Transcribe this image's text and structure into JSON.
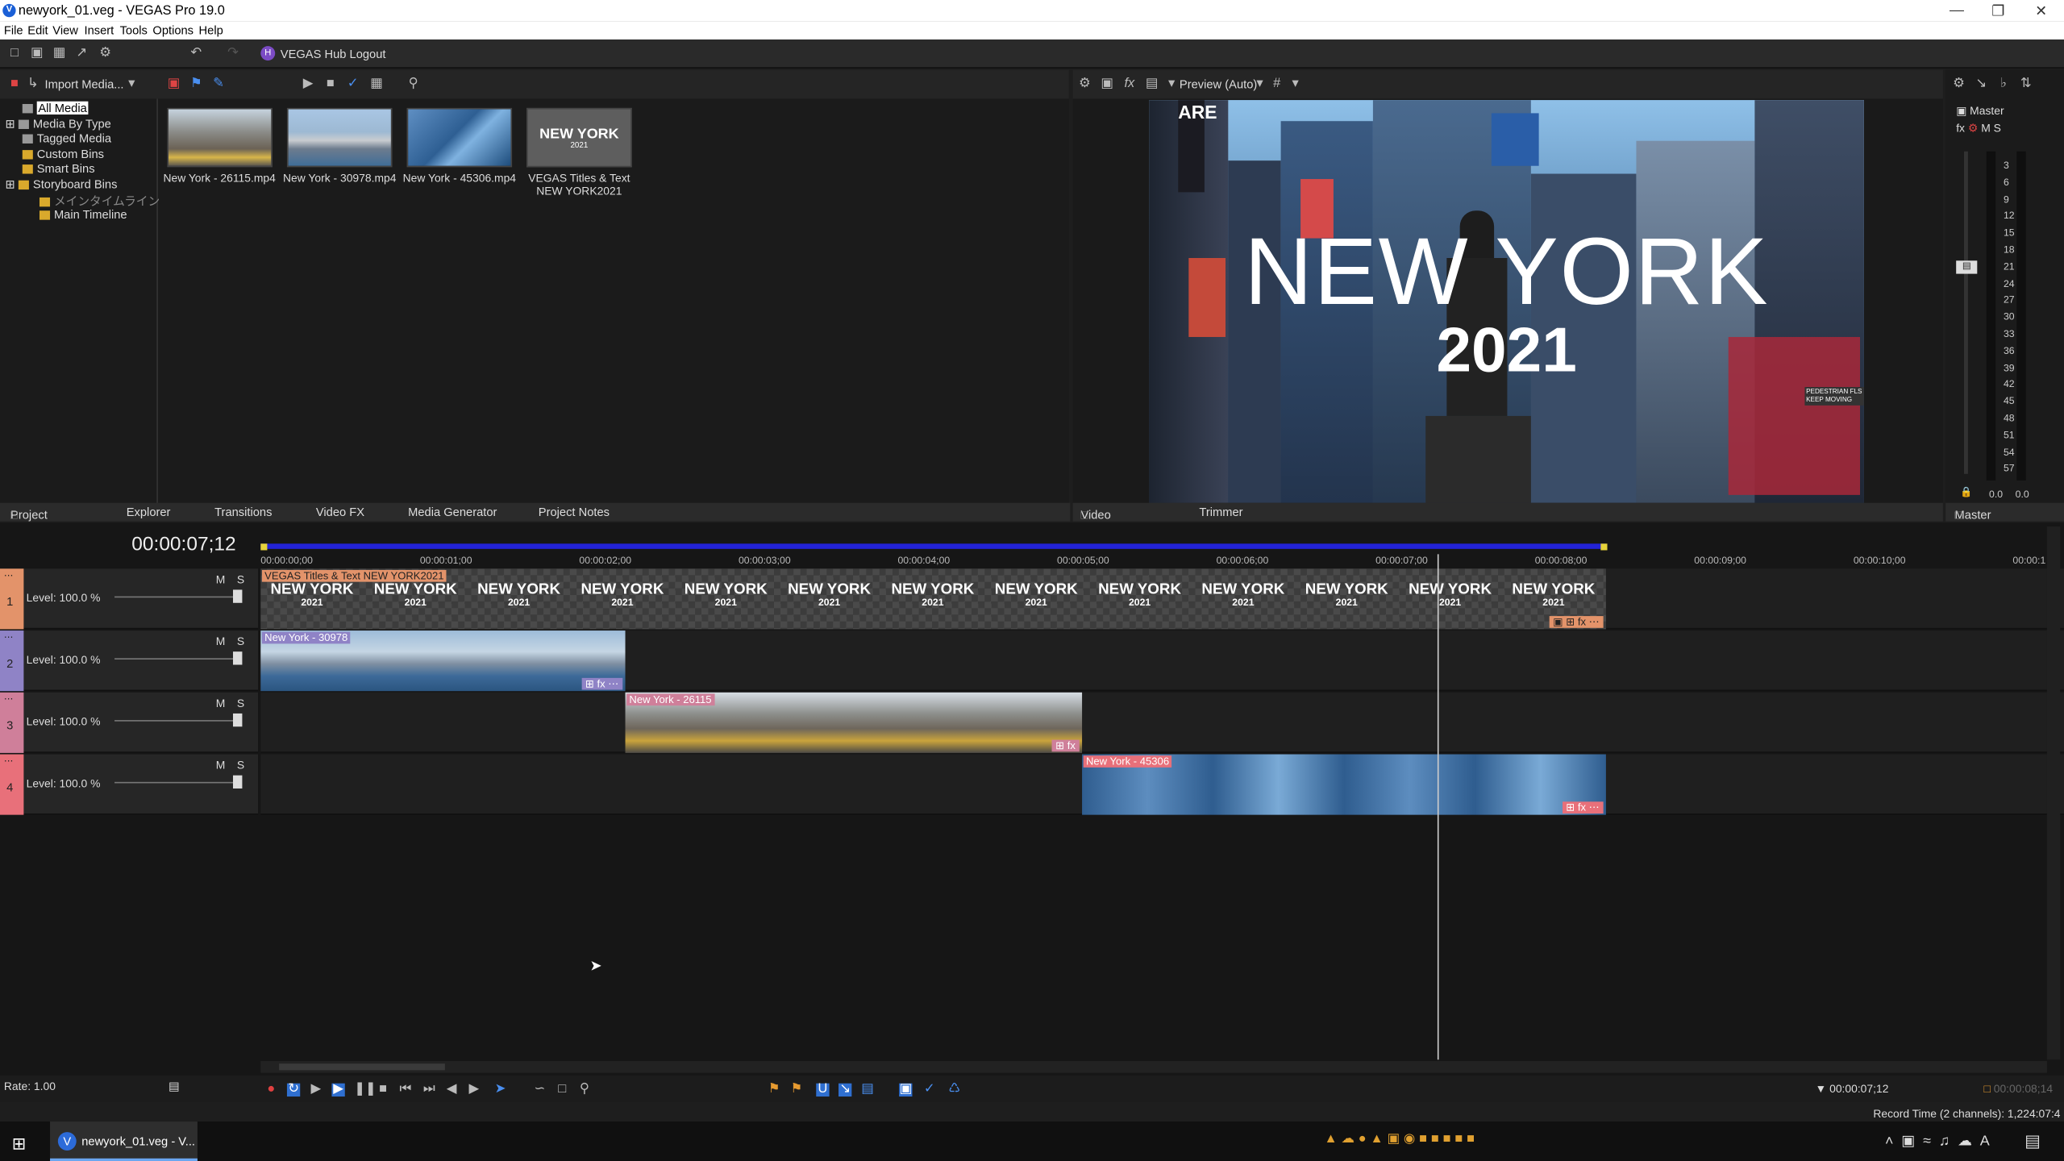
{
  "window": {
    "title": "newyork_01.veg - VEGAS Pro 19.0",
    "app_icon": "V"
  },
  "menu": [
    "File",
    "Edit",
    "View",
    "Insert",
    "Tools",
    "Options",
    "Help"
  ],
  "toolbar": {
    "hub_label": "VEGAS Hub Logout",
    "hub_icon": "H"
  },
  "media_toolbar": {
    "import_label": "Import Media..."
  },
  "media_tree": [
    {
      "label": "All Media",
      "selected": true
    },
    {
      "label": "Media By Type"
    },
    {
      "label": "Tagged Media"
    },
    {
      "label": "Custom Bins"
    },
    {
      "label": "Smart Bins"
    },
    {
      "label": "Storyboard Bins"
    },
    {
      "label": "メインタイムライン"
    },
    {
      "label": "Main Timeline"
    }
  ],
  "media_items": [
    {
      "caption": "New York - 26115.mp4"
    },
    {
      "caption": "New York - 30978.mp4"
    },
    {
      "caption": "New York - 45306.mp4"
    },
    {
      "caption_line1": "VEGAS Titles & Text",
      "caption_line2": "NEW YORK2021",
      "thumb_title": "NEW YORK",
      "thumb_sub": "2021"
    }
  ],
  "left_tabs": [
    "Project Media",
    "Explorer",
    "Transitions",
    "Video FX",
    "Media Generator",
    "Project Notes"
  ],
  "preview": {
    "mode_label": "Preview (Auto)",
    "title_big": "NEW YORK",
    "title_year": "2021",
    "sign1": "PEDESTRIAN FLS",
    "sign2": "KEEP MOVING",
    "sign3": "ARE"
  },
  "preview_tabs": [
    "Video Preview",
    "Trimmer"
  ],
  "master": {
    "label": "Master",
    "fx": "fx",
    "m": "M",
    "s": "S",
    "scale": [
      "3",
      "6",
      "9",
      "12",
      "15",
      "18",
      "21",
      "24",
      "27",
      "30",
      "33",
      "36",
      "39",
      "42",
      "45",
      "48",
      "51",
      "54",
      "57"
    ],
    "readout_l": "0.0",
    "readout_r": "0.0",
    "tab": "Master Bus"
  },
  "timeline": {
    "timecode": "00:00:07;12",
    "ruler": [
      "00:00:00;00",
      "00:00:01;00",
      "00:00:02;00",
      "00:00:03;00",
      "00:00:04;00",
      "00:00:05;00",
      "00:00:06;00",
      "00:00:07;00",
      "00:00:08;00",
      "00:00:09;00",
      "00:00:10;00",
      "00:00:1"
    ],
    "tracks": [
      {
        "num": "1",
        "level": "Level: 100.0 %",
        "m": "M",
        "s": "S",
        "color": "#e3936a"
      },
      {
        "num": "2",
        "level": "Level: 100.0 %",
        "m": "M",
        "s": "S",
        "color": "#8f83c6"
      },
      {
        "num": "3",
        "level": "Level: 100.0 %",
        "m": "M",
        "s": "S",
        "color": "#cf7f9a"
      },
      {
        "num": "4",
        "level": "Level: 100.0 %",
        "m": "M",
        "s": "S",
        "color": "#e8707a"
      }
    ],
    "clips": {
      "title": "VEGAS Titles & Text NEW YORK2021",
      "c2": "New York - 30978",
      "c3": "New York - 26115",
      "c4": "New York - 45306",
      "frame_title": "NEW YORK",
      "frame_year": "2021",
      "fx": "fx"
    },
    "rate": "Rate: 1.00",
    "cursor_time": "00:00:07;12",
    "end_time": "00:00:08;14",
    "record_time": "Record Time (2 channels): 1,224:07:4"
  },
  "taskbar": {
    "app_label": "newyork_01.veg - V...",
    "app_icon": "V"
  },
  "colors": {
    "accent": "#1a5fd6",
    "loop": "#2323d6"
  }
}
